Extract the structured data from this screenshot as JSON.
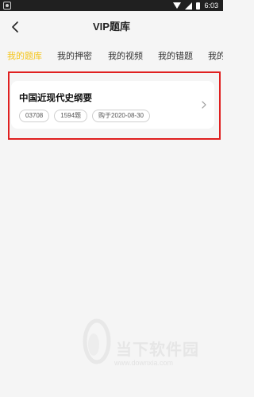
{
  "status_bar": {
    "time": "6:03",
    "icons": [
      "notification-icon",
      "wifi-icon",
      "signal-icon",
      "battery-icon"
    ]
  },
  "header": {
    "title": "VIP题库",
    "back_icon": "back-arrow-icon"
  },
  "tabs": [
    {
      "label": "我的题库",
      "active": true
    },
    {
      "label": "我的押密",
      "active": false
    },
    {
      "label": "我的视频",
      "active": false
    },
    {
      "label": "我的错题",
      "active": false
    },
    {
      "label": "我的",
      "active": false
    }
  ],
  "course_card": {
    "title": "中国近现代史纲要",
    "tags": [
      "03708",
      "1594题",
      "购于2020-08-30"
    ],
    "chevron_icon": "chevron-right-icon"
  },
  "watermark": {
    "name": "当下软件园",
    "url": "www.downxia.com"
  },
  "colors": {
    "accent": "#f5c518",
    "highlight_border": "#e02020",
    "background": "#f5f5f5"
  }
}
